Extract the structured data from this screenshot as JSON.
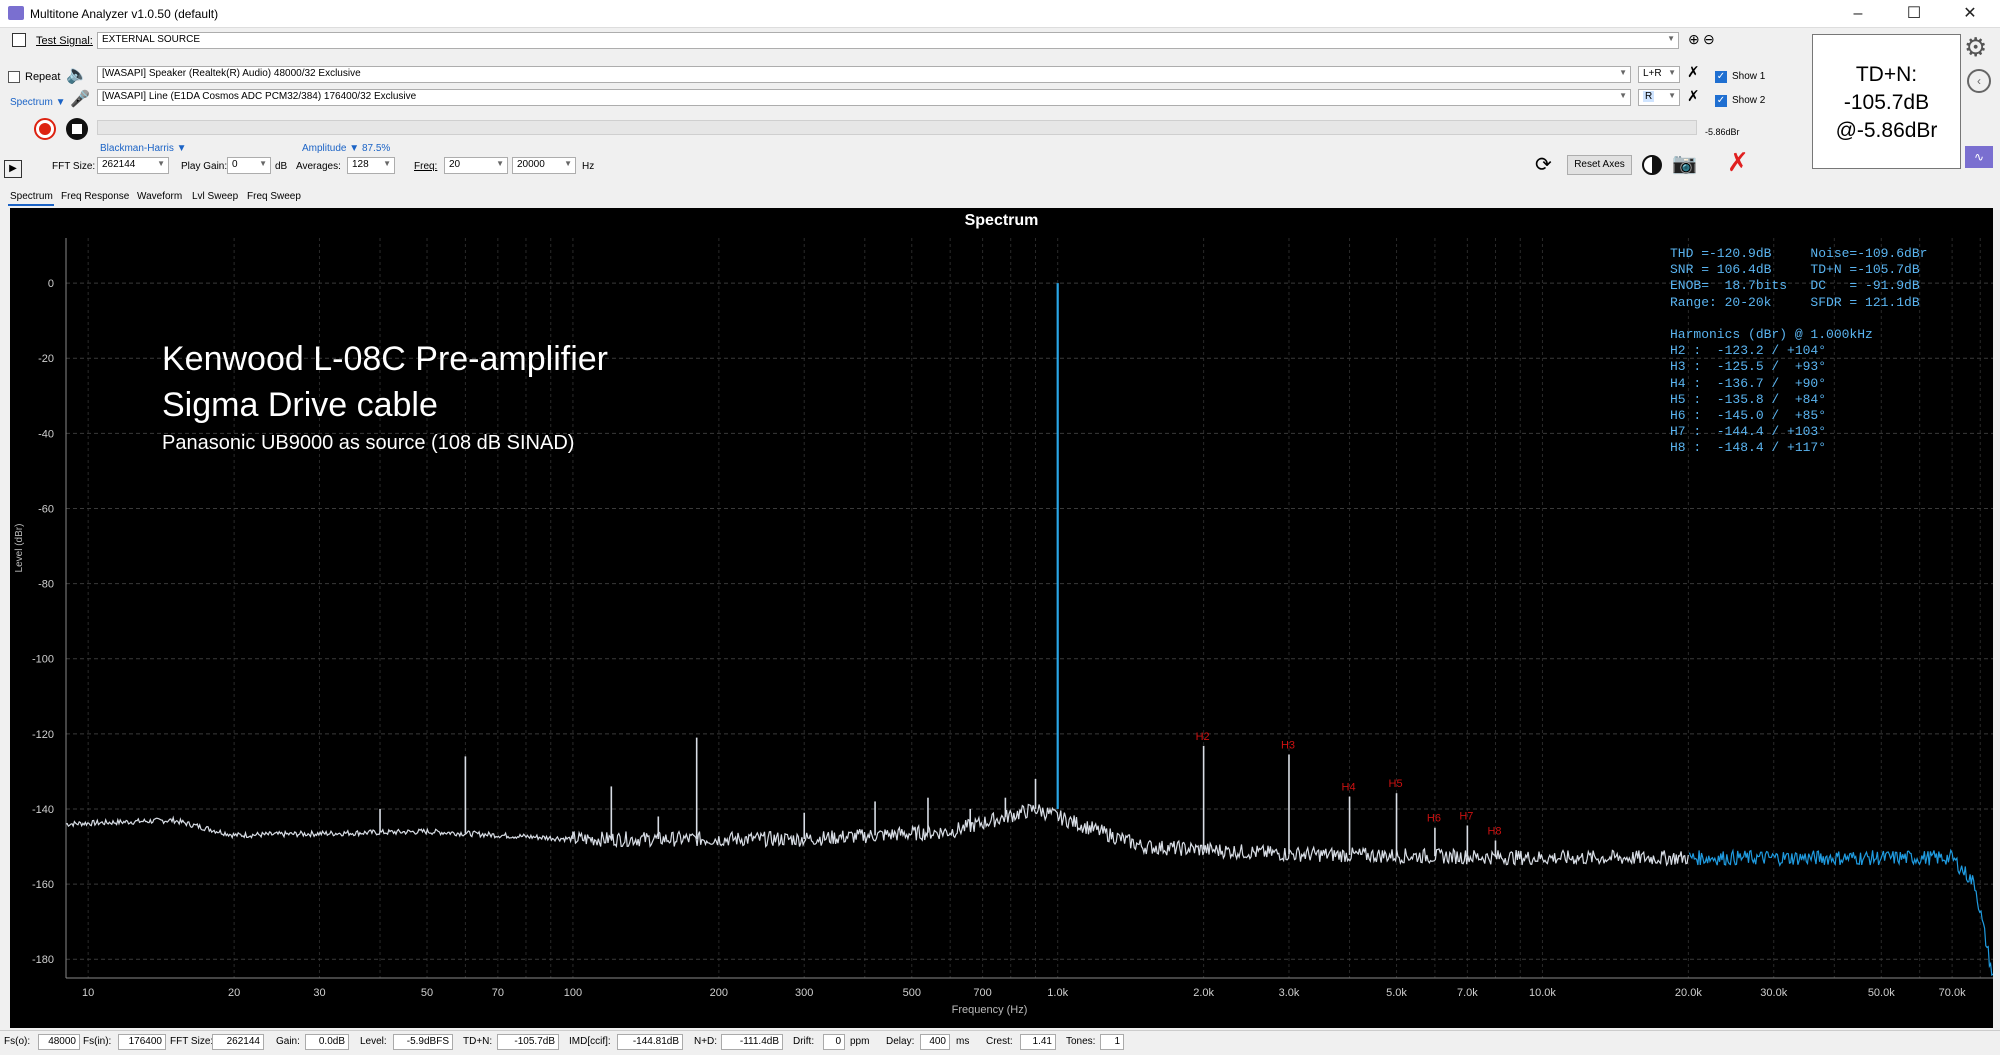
{
  "window": {
    "title": "Multitone Analyzer v1.0.50 (default)"
  },
  "toolbar": {
    "test_signal_label": "Test Signal:",
    "test_signal_value": "EXTERNAL SOURCE",
    "repeat_label": "Repeat",
    "spectrum_label": "Spectrum",
    "output_device": "[WASAPI] Speaker (Realtek(R) Audio) 48000/32 Exclusive",
    "input_device": "[WASAPI] Line (E1DA Cosmos ADC PCM32/384) 176400/32 Exclusive",
    "output_channel": "L+R",
    "input_channel": "R",
    "show1_label": "Show 1",
    "show2_label": "Show 2",
    "level_readout": "-5.86dBr",
    "window_fn": "Blackman-Harris",
    "amplitude_label": "Amplitude",
    "amplitude_value": "87.5%",
    "fft_size_label": "FFT Size:",
    "fft_size_value": "262144",
    "play_gain_label": "Play Gain:",
    "play_gain_value": "0",
    "play_gain_unit": "dB",
    "averages_label": "Averages:",
    "averages_value": "128",
    "freq_label": "Freq:",
    "freq_min": "20",
    "freq_max": "20000",
    "freq_unit": "Hz",
    "reset_axes_label": "Reset Axes"
  },
  "tdn_box": {
    "line1": "TD+N:",
    "line2": "-105.7dB",
    "line3": "@-5.86dBr"
  },
  "tabs": [
    "Spectrum",
    "Freq Response",
    "Waveform",
    "Lvl Sweep",
    "Freq Sweep"
  ],
  "chart_data": {
    "type": "line",
    "title": "Spectrum",
    "xlabel": "Frequency (Hz)",
    "ylabel": "Level (dBr)",
    "x_scale": "log",
    "xlim": [
      9,
      85000
    ],
    "ylim": [
      -185,
      12
    ],
    "y_ticks": [
      0,
      -20,
      -40,
      -60,
      -80,
      -100,
      -120,
      -140,
      -160,
      -180
    ],
    "x_ticks": [
      {
        "v": 10,
        "t": "10"
      },
      {
        "v": 20,
        "t": "20"
      },
      {
        "v": 30,
        "t": "30"
      },
      {
        "v": 50,
        "t": "50"
      },
      {
        "v": 70,
        "t": "70"
      },
      {
        "v": 100,
        "t": "100"
      },
      {
        "v": 200,
        "t": "200"
      },
      {
        "v": 300,
        "t": "300"
      },
      {
        "v": 500,
        "t": "500"
      },
      {
        "v": 700,
        "t": "700"
      },
      {
        "v": 1000,
        "t": "1.0k"
      },
      {
        "v": 2000,
        "t": "2.0k"
      },
      {
        "v": 3000,
        "t": "3.0k"
      },
      {
        "v": 5000,
        "t": "5.0k"
      },
      {
        "v": 7000,
        "t": "7.0k"
      },
      {
        "v": 10000,
        "t": "10.0k"
      },
      {
        "v": 20000,
        "t": "20.0k"
      },
      {
        "v": 30000,
        "t": "30.0k"
      },
      {
        "v": 50000,
        "t": "50.0k"
      },
      {
        "v": 70000,
        "t": "70.0k"
      }
    ],
    "grid": true,
    "annotation": {
      "line1": "Kenwood L-08C Pre-amplifier",
      "line2": "Sigma Drive cable",
      "line3": "Panasonic UB9000 as source (108 dB SINAD)"
    },
    "stats_lines": [
      "THD =-120.9dB     Noise=-109.6dBr",
      "SNR = 106.4dB     TD+N =-105.7dB",
      "ENOB=  18.7bits   DC   = -91.9dB",
      "Range: 20-20k     SFDR = 121.1dB",
      "",
      "Harmonics (dBr) @ 1.000kHz",
      "H2 :  -123.2 / +104°",
      "H3 :  -125.5 /  +93°",
      "H4 :  -136.7 /  +90°",
      "H5 :  -135.8 /  +84°",
      "H6 :  -145.0 /  +85°",
      "H7 :  -144.4 / +103°",
      "H8 :  -148.4 / +117°"
    ],
    "fundamental": {
      "f": 1000,
      "db": 0
    },
    "harmonics": [
      {
        "name": "H2",
        "f": 2000,
        "db": -123.2
      },
      {
        "name": "H3",
        "f": 3000,
        "db": -125.5
      },
      {
        "name": "H4",
        "f": 4000,
        "db": -136.7
      },
      {
        "name": "H5",
        "f": 5000,
        "db": -135.8
      },
      {
        "name": "H6",
        "f": 6000,
        "db": -145.0
      },
      {
        "name": "H7",
        "f": 7000,
        "db": -144.4
      },
      {
        "name": "H8",
        "f": 8000,
        "db": -148.4
      }
    ],
    "spurs": [
      {
        "f": 60,
        "db": -126
      },
      {
        "f": 120,
        "db": -134
      },
      {
        "f": 180,
        "db": -121
      },
      {
        "f": 40,
        "db": -140
      },
      {
        "f": 100,
        "db": -146
      },
      {
        "f": 150,
        "db": -142
      },
      {
        "f": 300,
        "db": -141
      },
      {
        "f": 420,
        "db": -138
      },
      {
        "f": 540,
        "db": -137
      },
      {
        "f": 660,
        "db": -140
      },
      {
        "f": 780,
        "db": -137
      },
      {
        "f": 900,
        "db": -132
      }
    ],
    "noise_floor": [
      {
        "f": 9,
        "db": -144
      },
      {
        "f": 15,
        "db": -143
      },
      {
        "f": 20,
        "db": -147
      },
      {
        "f": 50,
        "db": -146
      },
      {
        "f": 100,
        "db": -148
      },
      {
        "f": 300,
        "db": -148
      },
      {
        "f": 600,
        "db": -146
      },
      {
        "f": 900,
        "db": -140
      },
      {
        "f": 1500,
        "db": -150
      },
      {
        "f": 3000,
        "db": -152
      },
      {
        "f": 10000,
        "db": -153
      },
      {
        "f": 20000,
        "db": -153
      },
      {
        "f": 70000,
        "db": -153
      },
      {
        "f": 78000,
        "db": -160
      },
      {
        "f": 85000,
        "db": -185
      }
    ],
    "colors": {
      "trace": "#d8dde5",
      "trace_outband": "#1f9be0",
      "fundamental": "#2aa6e6",
      "harmonic_label": "#cc1111",
      "stats": "#5ab4f0"
    }
  },
  "statusbar": {
    "fs_in_label": "Fs(o):",
    "fs_out_value": "48000",
    "fs_i_label": "Fs(in):",
    "fs_in_value": "176400",
    "fft_label": "FFT Size:",
    "fft_value": "262144",
    "gain_label": "Gain:",
    "gain_value": "0.0dB",
    "level_label": "Level:",
    "level_value": "-5.9dBFS",
    "tdn_label": "TD+N:",
    "tdn_value": "-105.7dB",
    "imd_label": "IMD[ccif]:",
    "imd_value": "-144.81dB",
    "nd_label": "N+D:",
    "nd_value": "-111.4dB",
    "drift_label": "Drift:",
    "drift_value": "0",
    "drift_unit": "ppm",
    "delay_label": "Delay:",
    "delay_value": "400",
    "delay_unit": "ms",
    "crest_label": "Crest:",
    "crest_value": "1.41",
    "tones_label": "Tones:",
    "tones_value": "1"
  }
}
